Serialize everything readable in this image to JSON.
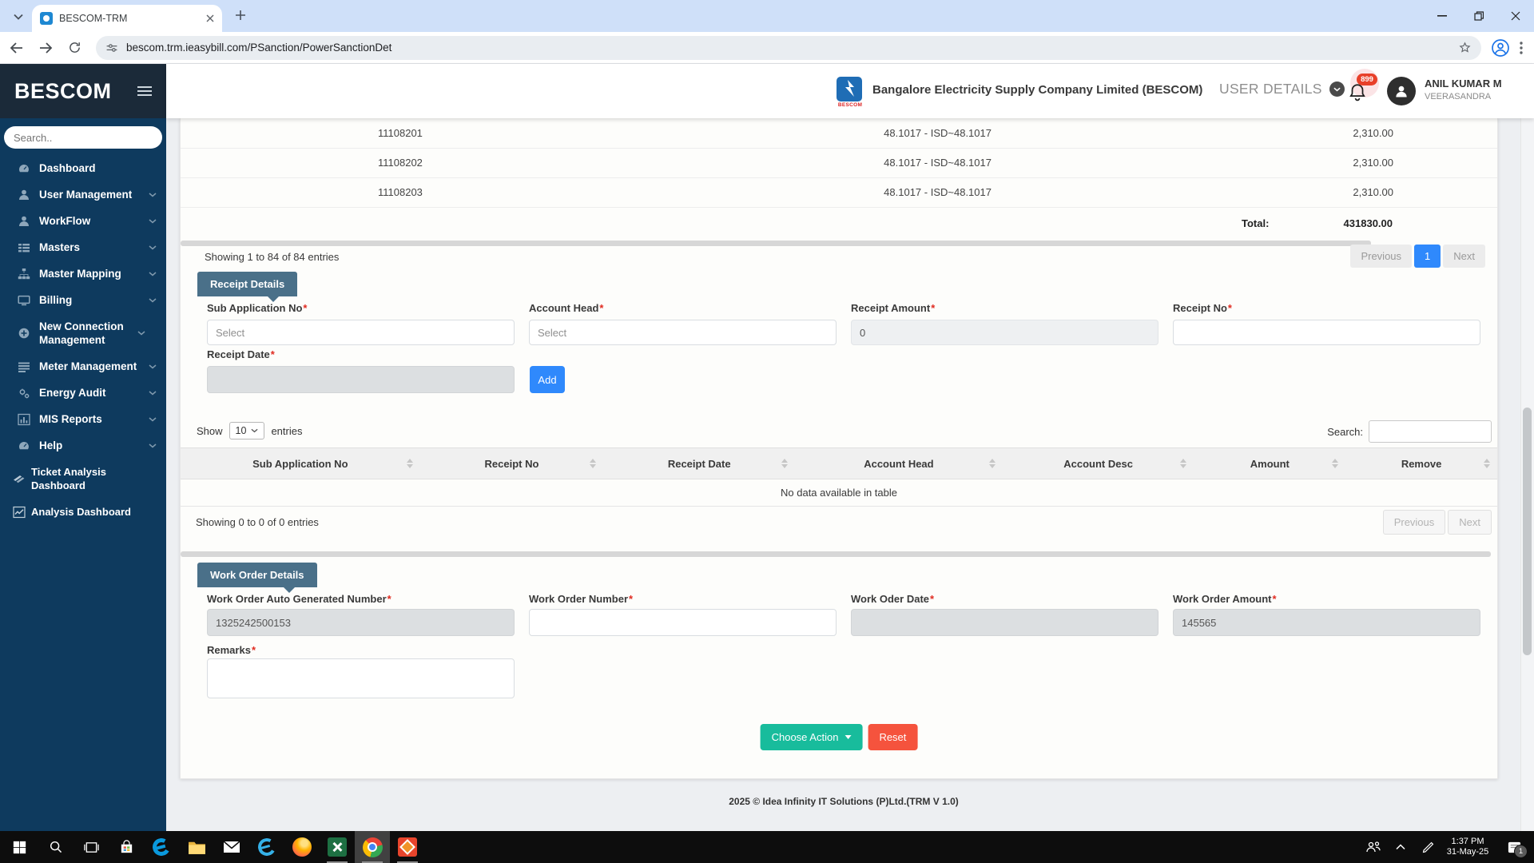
{
  "colors": {
    "sidebar": "#0e3a5e",
    "sidebar_header": "#1b2a39",
    "section_tab": "#4a7089",
    "primary_blue": "#2f89fc",
    "action_green": "#18bc9c",
    "reset_red": "#f5533d",
    "badge_red": "#e8402a",
    "tabstrip_blue": "#cfe0f9"
  },
  "icons": {
    "sidebar_search": "magnifier",
    "notifications": "bell-outline",
    "user_details": "chevron-down-circle",
    "sort": "up-down-triangles",
    "choose_action": "caret-down",
    "page_size": "chevron-down"
  },
  "browser": {
    "tab_title": "BESCOM-TRM",
    "url": "bescom.trm.ieasybill.com/PSanction/PowerSanctionDet"
  },
  "header": {
    "company": "Bangalore Electricity Supply Company Limited (BESCOM)",
    "logo_caption": "BESCOM",
    "user_details": "USER DETAILS",
    "notification_count": "899",
    "user_name": "ANIL KUMAR M",
    "user_branch": "VEERASANDRA"
  },
  "sidebar": {
    "brand": "BESCOM",
    "search_placeholder": "Search..",
    "items": [
      {
        "label": "Dashboard"
      },
      {
        "label": "User Management"
      },
      {
        "label": "WorkFlow"
      },
      {
        "label": "Masters"
      },
      {
        "label": "Master Mapping"
      },
      {
        "label": "Billing"
      },
      {
        "label": "New Connection Management"
      },
      {
        "label": "Meter Management"
      },
      {
        "label": "Energy Audit"
      },
      {
        "label": "MIS Reports"
      },
      {
        "label": "Help"
      },
      {
        "label": "Ticket Analysis Dashboard"
      },
      {
        "label": "Analysis Dashboard"
      }
    ]
  },
  "sanction_table": {
    "rows": [
      {
        "id": "11108201",
        "isd": "48.1017 - ISD~48.1017",
        "amount": "2,310.00"
      },
      {
        "id": "11108202",
        "isd": "48.1017 - ISD~48.1017",
        "amount": "2,310.00"
      },
      {
        "id": "11108203",
        "isd": "48.1017 - ISD~48.1017",
        "amount": "2,310.00"
      }
    ],
    "total_label": "Total:",
    "total_value": "431830.00",
    "showing": "Showing 1 to 84 of 84 entries",
    "prev": "Previous",
    "page": "1",
    "next": "Next"
  },
  "receipt": {
    "title": "Receipt Details",
    "req": "*",
    "sub_app_label": "Sub Application No",
    "sub_app_value": "Select",
    "account_head_label": "Account Head",
    "account_head_value": "Select",
    "amount_label": "Receipt Amount",
    "amount_value": "0",
    "no_label": "Receipt No",
    "no_value": "",
    "date_label": "Receipt Date",
    "date_value": "",
    "add": "Add",
    "show_label": "Show",
    "page_size": "10",
    "entries_label": "entries",
    "search_label": "Search:",
    "search_value": "",
    "columns": [
      "Sub Application No",
      "Receipt No",
      "Receipt Date",
      "Account Head",
      "Account Desc",
      "Amount",
      "Remove"
    ],
    "empty": "No data available in table",
    "showing": "Showing 0 to 0 of 0 entries",
    "prev": "Previous",
    "next": "Next"
  },
  "work_order": {
    "title": "Work Order Details",
    "req": "*",
    "auto_label": "Work Order Auto Generated Number",
    "auto_value": "1325242500153",
    "number_label": "Work Order Number",
    "number_value": "",
    "date_label": "Work Oder Date",
    "date_value": "",
    "amount_label": "Work Order Amount",
    "amount_value": "145565",
    "remarks_label": "Remarks",
    "remarks_value": ""
  },
  "actions": {
    "choose_action": "Choose Action",
    "reset": "Reset"
  },
  "footer": {
    "text": "2025 © Idea Infinity IT Solutions (P)Ltd.(TRM V 1.0)"
  },
  "taskbar": {
    "time": "1:37 PM",
    "date": "31-May-25",
    "notification_count": "1"
  }
}
